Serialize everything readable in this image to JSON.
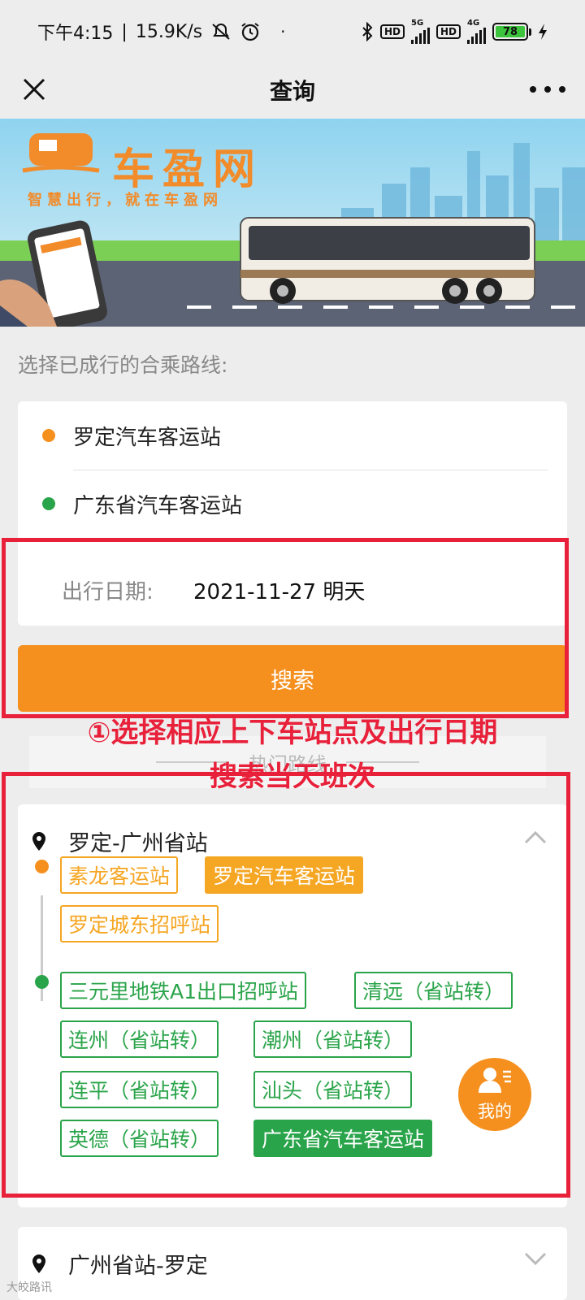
{
  "status_bar": {
    "time": "下午4:15",
    "speed": "15.9K/s",
    "battery": "78",
    "network1": "5G",
    "network2": "4G",
    "hd": "HD"
  },
  "nav": {
    "title": "查询"
  },
  "banner": {
    "brand": "车盈网",
    "slogan": "智慧出行，就在车盈网"
  },
  "section_label": "选择已成行的合乘路线:",
  "route": {
    "from": "罗定汽车客运站",
    "to": "广东省汽车客运站",
    "date_label": "出行日期:",
    "date_value": "2021-11-27 明天"
  },
  "search_button": "搜索",
  "faded_tab": "热门路线",
  "annotation": {
    "line1": "①选择相应上下车站点及出行日期",
    "line2": "搜索当天班次"
  },
  "line1": {
    "name": "罗定-广州省站",
    "board": [
      "素龙客运站",
      "罗定汽车客运站",
      "罗定城东招呼站"
    ],
    "alight": [
      "三元里地铁A1出口招呼站",
      "清远（省站转）",
      "连州（省站转）",
      "潮州（省站转）",
      "连平（省站转）",
      "汕头（省站转）",
      "英德（省站转）",
      "广东省汽车客运站"
    ]
  },
  "my_button": "我的",
  "line2": {
    "name": "广州省站-罗定"
  },
  "watermark": "大皎路讯",
  "colors": {
    "orange": "#f5901f",
    "chip_orange": "#f5a623",
    "green": "#2aa44a",
    "annotation_red": "#e8203a"
  }
}
